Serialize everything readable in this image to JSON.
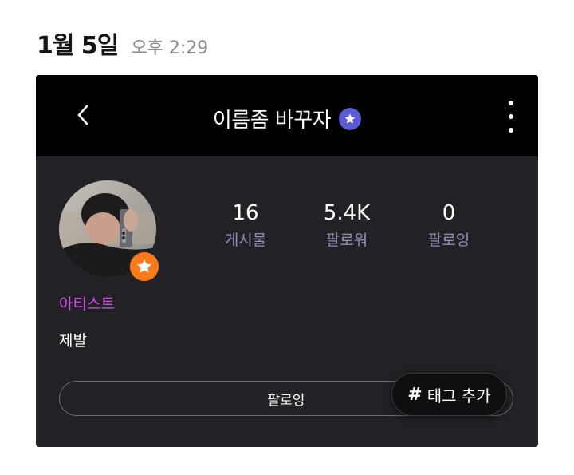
{
  "message": {
    "date": "1월 5일",
    "time": "오후 2:29"
  },
  "profile": {
    "title": "이름좀 바꾸자",
    "back_icon": "chevron-left-icon",
    "verified_icon": "star-badge-icon",
    "more_icon": "vertical-dots-icon",
    "avatar_badge_icon": "star-icon",
    "role": "아티스트",
    "bio": "제발",
    "stats": [
      {
        "value": "16",
        "label": "게시물"
      },
      {
        "value": "5.4K",
        "label": "팔로워"
      },
      {
        "value": "0",
        "label": "팔로잉"
      }
    ],
    "follow_button_label": "팔로잉",
    "tag_button_hash": "#",
    "tag_button_label": "태그 추가",
    "colors": {
      "card_bg": "#222226",
      "topbar_bg": "#000000",
      "verified": "#5b5bd6",
      "badge": "#ff7a1a",
      "role": "#d14de6",
      "stat_label": "#8f8fb8"
    }
  }
}
